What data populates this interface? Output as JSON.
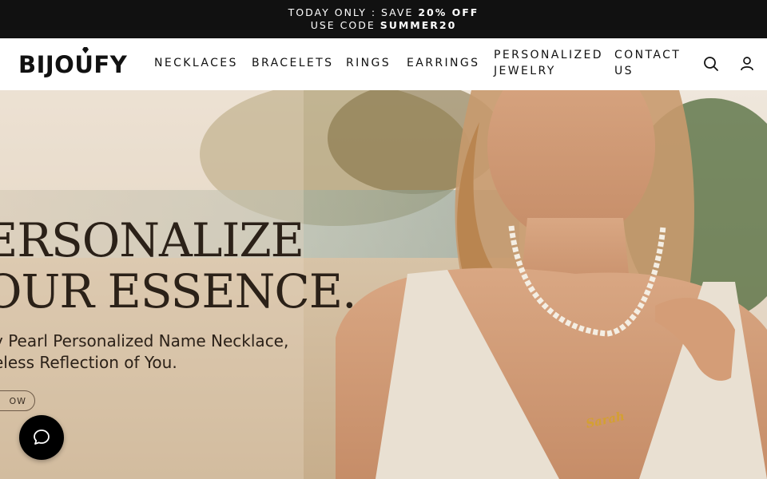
{
  "announcement": {
    "line1_prefix": "TODAY ONLY : SAVE ",
    "line1_bold": "20% OFF",
    "line2_prefix": "USE CODE ",
    "line2_bold": "SUMMER20"
  },
  "header": {
    "logo": "BIJOUFY",
    "nav": [
      {
        "line1": "NECKLACES",
        "line2": ""
      },
      {
        "line1": "BRACELETS",
        "line2": ""
      },
      {
        "line1": "RINGS",
        "line2": ""
      },
      {
        "line1": "EARRINGS",
        "line2": ""
      },
      {
        "line1": "PERSONALIZED",
        "line2": "JEWELRY"
      },
      {
        "line1": "CONTACT",
        "line2": "US"
      }
    ],
    "icons": {
      "search": "search-icon",
      "account": "user-icon"
    }
  },
  "hero": {
    "headline_line1": "ERSONALIZE",
    "headline_line2": "OUR ESSENCE.",
    "sub_line1": "y Pearl Personalized Name Necklace,",
    "sub_line2": "eless Reflection of You.",
    "cta": "OW",
    "necklace_name": "Sarah"
  },
  "chat": {
    "icon": "chat-bubble-icon"
  },
  "colors": {
    "announcement_bg": "#111111",
    "text_dark": "#2b2118",
    "chat_bg": "#000000"
  }
}
